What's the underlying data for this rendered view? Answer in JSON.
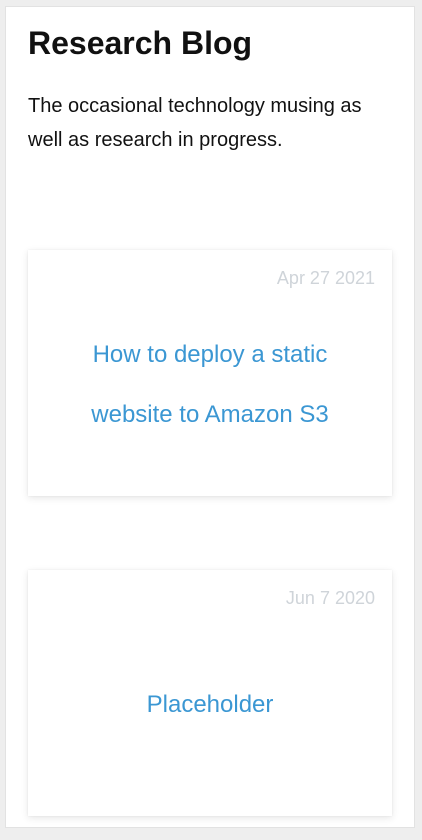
{
  "header": {
    "title": "Research Blog",
    "description": "The occasional technology musing as well as research in progress."
  },
  "posts": [
    {
      "date": "Apr 27 2021",
      "title": "How to deploy a static website to Amazon S3"
    },
    {
      "date": "Jun 7 2020",
      "title": "Placeholder"
    }
  ],
  "colors": {
    "link": "#3b97d3",
    "date": "#cfd4d9",
    "text": "#111111"
  }
}
